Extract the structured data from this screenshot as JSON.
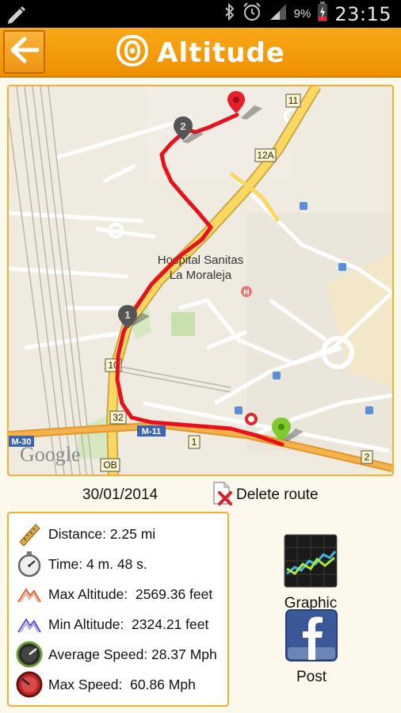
{
  "status_bar": {
    "battery": "9%",
    "time": "23:15",
    "icons": [
      "pencil-icon",
      "bluetooth-icon",
      "alarm-icon",
      "signal-icon",
      "battery-charging-icon"
    ]
  },
  "header": {
    "title": "Altitude",
    "back_icon": "back-arrow-icon",
    "logo_icon": "app-logo-icon"
  },
  "map": {
    "labels": {
      "hospital_line1": "Hospital Sanitas",
      "hospital_line2": "La Moraleja",
      "road_m30": "M-30",
      "road_m11": "M-11",
      "exit_11": "11",
      "exit_12a": "12A",
      "exit_10": "10",
      "exit_32": "32",
      "exit_ob": "OB",
      "exit_1": "1",
      "exit_2": "2",
      "google": "Google"
    },
    "markers": [
      {
        "label": "1",
        "kind": "waypoint"
      },
      {
        "label": "2",
        "kind": "waypoint"
      },
      {
        "label": "",
        "kind": "start"
      },
      {
        "label": "",
        "kind": "end"
      }
    ],
    "route_color": "#e8101a"
  },
  "route": {
    "date": "30/01/2014",
    "delete_label": "Delete route"
  },
  "stats": [
    {
      "icon": "ruler-icon",
      "label": "Distance: 2.25 mi"
    },
    {
      "icon": "stopwatch-icon",
      "label": "Time: 4 m. 48 s."
    },
    {
      "icon": "max-altitude-icon",
      "label": "Max Altitude:  2569.36 feet"
    },
    {
      "icon": "min-altitude-icon",
      "label": "Min Altitude:  2324.21 feet"
    },
    {
      "icon": "average-speed-icon",
      "label": "Average Speed: 28.37 Mph"
    },
    {
      "icon": "max-speed-icon",
      "label": "Max Speed:  60.86 Mph"
    }
  ],
  "actions": {
    "graphic_label": "Graphic",
    "post_label": "Post"
  },
  "colors": {
    "accent": "#f5a010",
    "panel_border": "#f0b030",
    "route": "#e8101a"
  }
}
